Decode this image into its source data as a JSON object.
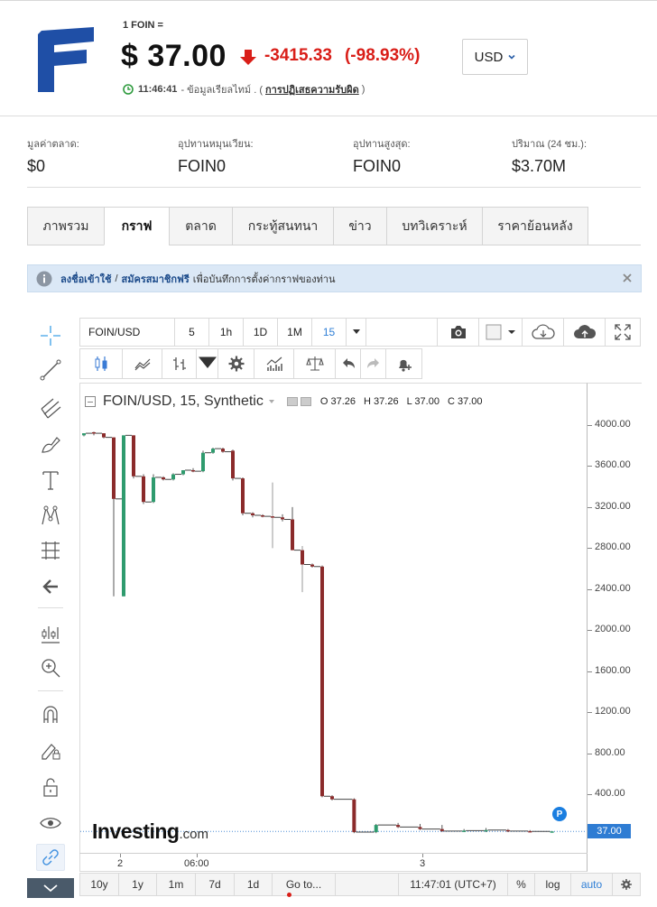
{
  "header": {
    "unit_label": "1 FOIN =",
    "price": "$ 37.00",
    "change": "-3415.33",
    "change_pct": "(-98.93%)",
    "time": "11:46:41",
    "realtime_text": "- ข้อมูลเรียลไทม์ . (",
    "disclaimer_link": "การปฏิเสธความรับผิด",
    "close_paren": ")",
    "currency": "USD",
    "colors": {
      "down": "#d91e18",
      "logo_blue": "#1f4fa6",
      "accent": "#2f7fd6"
    }
  },
  "stats": [
    {
      "label": "มูลค่าตลาด:",
      "value": "$0"
    },
    {
      "label": "อุปทานหมุนเวียน:",
      "value": "FOIN0"
    },
    {
      "label": "อุปทานสูงสุด:",
      "value": "FOIN0"
    },
    {
      "label": "ปริมาณ (24 ชม.):",
      "value": "$3.70M"
    }
  ],
  "tabs": [
    {
      "label": "ภาพรวม",
      "active": false
    },
    {
      "label": "กราฟ",
      "active": true
    },
    {
      "label": "ตลาด",
      "active": false
    },
    {
      "label": "กระทู้สนทนา",
      "active": false
    },
    {
      "label": "ข่าว",
      "active": false
    },
    {
      "label": "บทวิเคราะห์",
      "active": false
    },
    {
      "label": "ราคาย้อนหลัง",
      "active": false
    }
  ],
  "notice": {
    "login": "ลงชื่อเข้าใช้",
    "sep": "/",
    "signup": "สมัครสมาชิกฟรี",
    "text": "เพื่อบันทึกการตั้งค่ากราฟของท่าน"
  },
  "chart_header": {
    "symbol": "FOIN/USD",
    "timeframes": [
      "5",
      "1h",
      "1D",
      "1M",
      "15"
    ],
    "active_timeframe": "15"
  },
  "left_tools": [
    "crosshair-icon",
    "trendline-icon",
    "pitchfork-icon",
    "brush-icon",
    "text-icon",
    "pattern-icon",
    "fib-icon",
    "back-arrow-icon",
    "measure-icon",
    "zoom-icon",
    "magnet-icon",
    "lock-drawing-icon",
    "unlock-icon",
    "eye-icon",
    "link-icon"
  ],
  "legend": {
    "title": "FOIN/USD, 15, Synthetic",
    "o": "O 37.26",
    "h": "H 37.26",
    "l": "L 37.00",
    "c": "C 37.00"
  },
  "watermark": {
    "brand": "Investing",
    "suffix": ".com"
  },
  "badge": "P",
  "bottom_bar": {
    "ranges": [
      "10y",
      "1y",
      "1m",
      "7d",
      "1d"
    ],
    "goto": "Go to...",
    "time": "11:47:01 (UTC+7)",
    "pct": "%",
    "log": "log",
    "auto": "auto"
  },
  "chart_data": {
    "type": "candlestick",
    "x_ticks": [
      "2",
      "06:00",
      "3"
    ],
    "y_ticks": [
      "400.00",
      "800.00",
      "1200.00",
      "1600.00",
      "2000.00",
      "2400.00",
      "2800.00",
      "3200.00",
      "3600.00",
      "4000.00"
    ],
    "last_price": "37.00",
    "ylim": [
      -330,
      4130
    ],
    "candles": [
      {
        "o": 3900,
        "h": 3920,
        "c": 3920,
        "l": 3890
      },
      {
        "o": 3930,
        "h": 3935,
        "c": 3920,
        "l": 3900
      },
      {
        "o": 3920,
        "h": 3920,
        "c": 3880,
        "l": 3870
      },
      {
        "o": 3880,
        "h": 3880,
        "c": 3280,
        "l": 2330
      },
      {
        "o": 2330,
        "h": 3900,
        "c": 3900,
        "l": 2330
      },
      {
        "o": 3900,
        "h": 3900,
        "c": 3500,
        "l": 3480
      },
      {
        "o": 3500,
        "h": 3520,
        "c": 3250,
        "l": 3230
      },
      {
        "o": 3250,
        "h": 3520,
        "c": 3490,
        "l": 3240
      },
      {
        "o": 3490,
        "h": 3500,
        "c": 3470,
        "l": 3460
      },
      {
        "o": 3470,
        "h": 3530,
        "c": 3520,
        "l": 3460
      },
      {
        "o": 3520,
        "h": 3560,
        "c": 3560,
        "l": 3510
      },
      {
        "o": 3560,
        "h": 3580,
        "c": 3550,
        "l": 3540
      },
      {
        "o": 3550,
        "h": 3750,
        "c": 3730,
        "l": 3540
      },
      {
        "o": 3730,
        "h": 3780,
        "c": 3770,
        "l": 3720
      },
      {
        "o": 3770,
        "h": 3780,
        "c": 3740,
        "l": 3730
      },
      {
        "o": 3750,
        "h": 3760,
        "c": 3480,
        "l": 3460
      },
      {
        "o": 3480,
        "h": 3490,
        "c": 3140,
        "l": 3120
      },
      {
        "o": 3140,
        "h": 3150,
        "c": 3120,
        "l": 3100
      },
      {
        "o": 3120,
        "h": 3130,
        "c": 3110,
        "l": 3100
      },
      {
        "o": 3110,
        "h": 3440,
        "c": 3100,
        "l": 2800
      },
      {
        "o": 3100,
        "h": 3130,
        "c": 3080,
        "l": 3060
      },
      {
        "o": 3080,
        "h": 3200,
        "c": 2780,
        "l": 2780
      },
      {
        "o": 2780,
        "h": 2820,
        "c": 2640,
        "l": 2370
      },
      {
        "o": 2640,
        "h": 2650,
        "c": 2620,
        "l": 2610
      },
      {
        "o": 2620,
        "h": 2630,
        "c": 380,
        "l": 370
      },
      {
        "o": 380,
        "h": 390,
        "c": 350,
        "l": 340
      },
      {
        "o": 350,
        "h": 360,
        "c": 30,
        "l": 20
      },
      {
        "o": 30,
        "h": 110,
        "c": 100,
        "l": 20
      },
      {
        "o": 100,
        "h": 120,
        "c": 80,
        "l": 70
      },
      {
        "o": 80,
        "h": 110,
        "c": 60,
        "l": 50
      },
      {
        "o": 60,
        "h": 100,
        "c": 40,
        "l": 30
      },
      {
        "o": 40,
        "h": 60,
        "c": 45,
        "l": 30
      },
      {
        "o": 45,
        "h": 70,
        "c": 50,
        "l": 30
      },
      {
        "o": 50,
        "h": 60,
        "c": 40,
        "l": 30
      },
      {
        "o": 40,
        "h": 50,
        "c": 37,
        "l": 30
      },
      {
        "o": 37,
        "h": 40,
        "c": 37,
        "l": 35
      }
    ]
  }
}
